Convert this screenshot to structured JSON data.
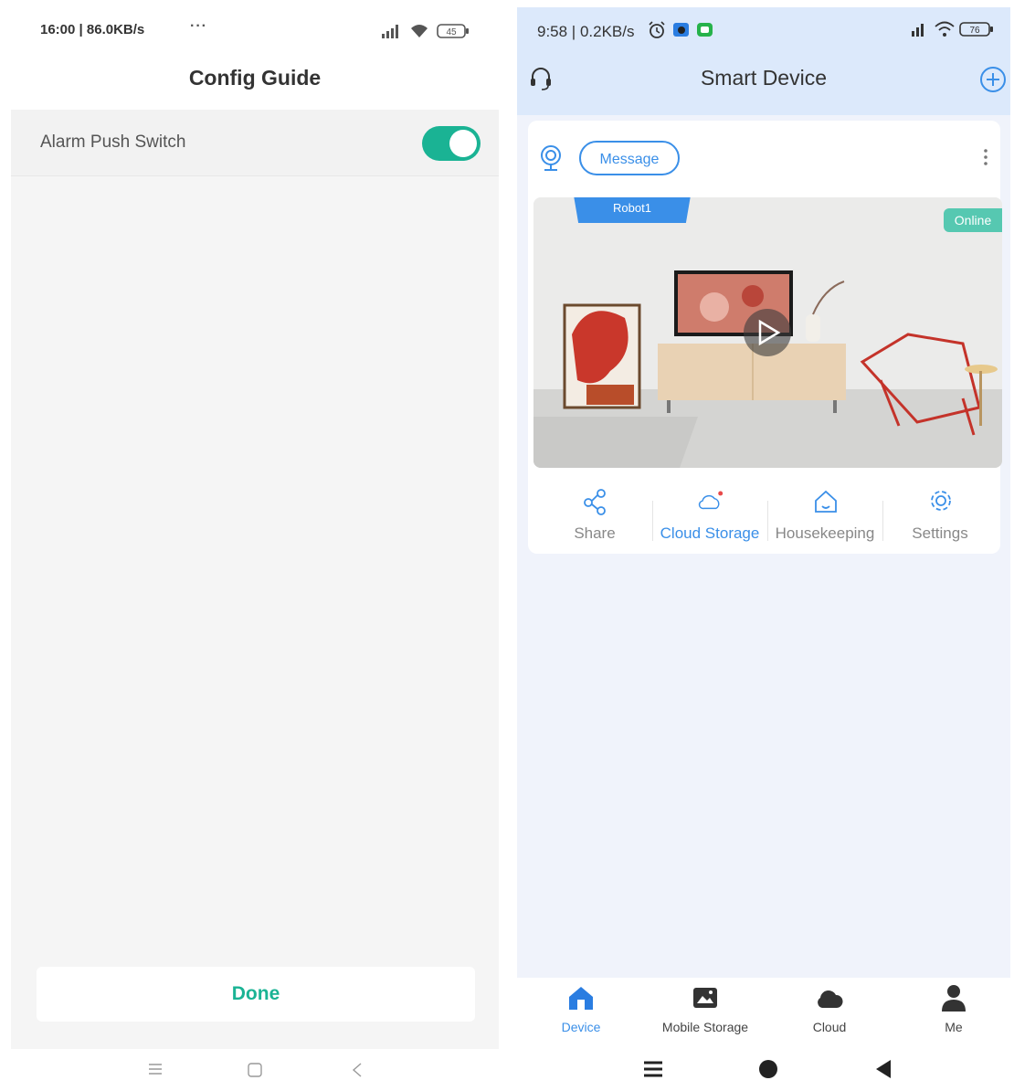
{
  "left": {
    "status": {
      "time": "16:00 | 86.0KB/s",
      "more": "···",
      "battery": "45"
    },
    "title": "Config Guide",
    "setting": {
      "label": "Alarm Push Switch",
      "enabled": true
    },
    "done_label": "Done"
  },
  "right": {
    "status": {
      "time": "9:58 | 0.2KB/s",
      "battery": "76"
    },
    "title": "Smart Device",
    "message_label": "Message",
    "device_name": "Robot1",
    "online_label": "Online",
    "actions": [
      {
        "label": "Share",
        "icon": "share-icon"
      },
      {
        "label": "Cloud Storage",
        "icon": "cloud-icon"
      },
      {
        "label": "Housekeeping",
        "icon": "home-icon"
      },
      {
        "label": "Settings",
        "icon": "gear-icon"
      }
    ],
    "tabs": [
      {
        "label": "Device",
        "icon": "home-icon",
        "active": true
      },
      {
        "label": "Mobile Storage",
        "icon": "image-icon"
      },
      {
        "label": "Cloud",
        "icon": "cloud-icon"
      },
      {
        "label": "Me",
        "icon": "person-icon"
      }
    ]
  },
  "colors": {
    "teal": "#1ab394",
    "blue": "#3a8fe8",
    "header": "#dce9fb"
  }
}
